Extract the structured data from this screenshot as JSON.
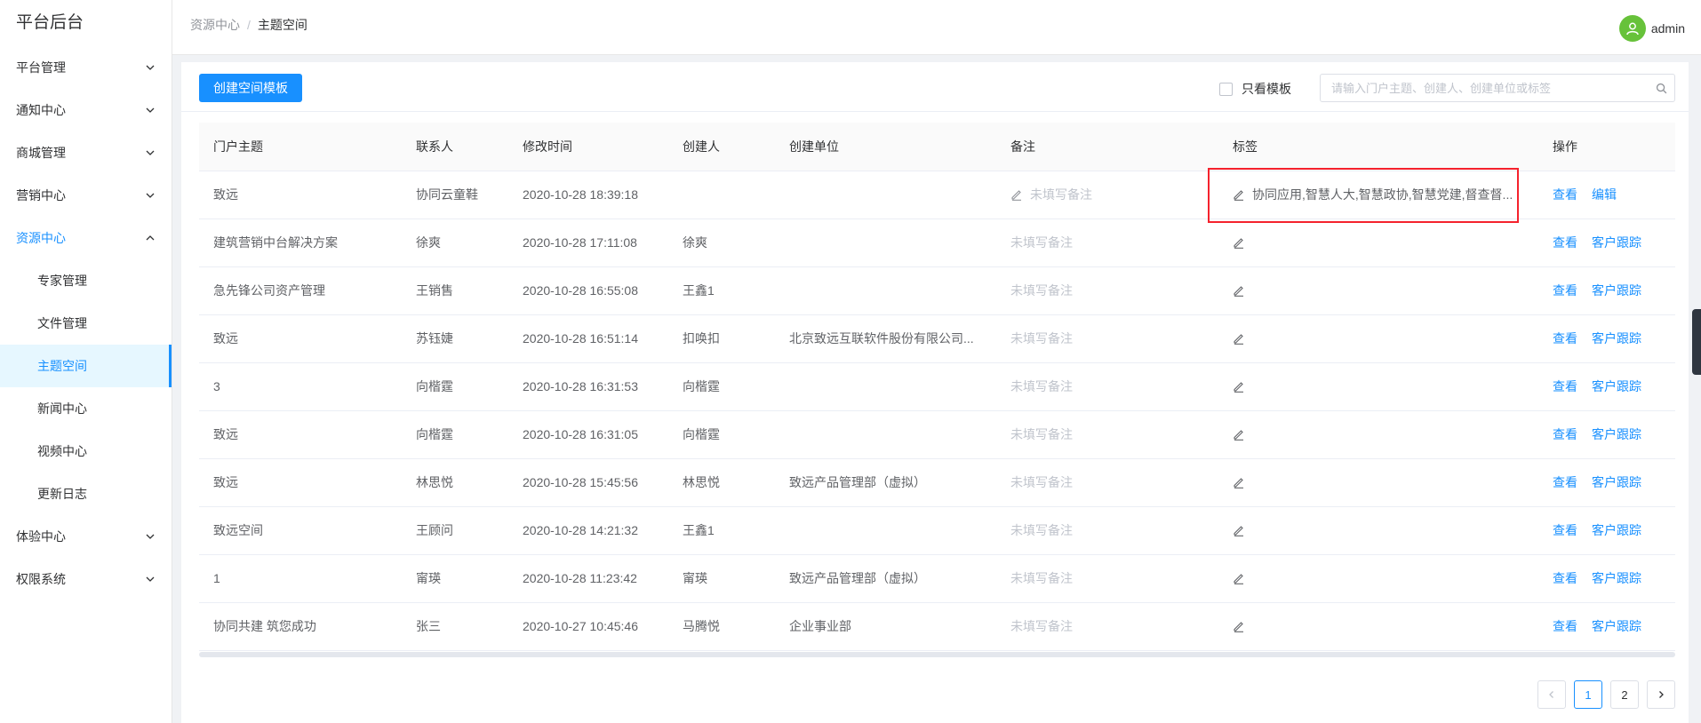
{
  "sidebar": {
    "title": "平台后台",
    "menu": [
      {
        "label": "平台管理"
      },
      {
        "label": "通知中心"
      },
      {
        "label": "商城管理"
      },
      {
        "label": "营销中心"
      },
      {
        "label": "资源中心",
        "open": true
      },
      {
        "label": "体验中心"
      },
      {
        "label": "权限系统"
      }
    ],
    "submenu": [
      {
        "label": "专家管理"
      },
      {
        "label": "文件管理"
      },
      {
        "label": "主题空间",
        "active": true
      },
      {
        "label": "新闻中心"
      },
      {
        "label": "视频中心"
      },
      {
        "label": "更新日志"
      }
    ]
  },
  "header": {
    "breadcrumb": [
      "资源中心",
      "主题空间"
    ],
    "separator": "/",
    "user": "admin"
  },
  "toolbar": {
    "create_label": "创建空间模板",
    "template_only_label": "只看模板",
    "search_placeholder": "请输入门户主题、创建人、创建单位或标签"
  },
  "table": {
    "columns": [
      "门户主题",
      "联系人",
      "修改时间",
      "创建人",
      "创建单位",
      "备注",
      "标签",
      "操作"
    ],
    "rows": [
      {
        "theme": "致远",
        "contact": "协同云童鞋",
        "modified": "2020-10-28 18:39:18",
        "creator": "",
        "unit": "",
        "remark": "未填写备注",
        "tags": "协同应用,智慧人大,智慧政协,智慧党建,督查督...",
        "actions": [
          "查看",
          "编辑"
        ]
      },
      {
        "theme": "建筑营销中台解决方案",
        "contact": "徐爽",
        "modified": "2020-10-28 17:11:08",
        "creator": "徐爽",
        "unit": "",
        "remark": "未填写备注",
        "tags": "",
        "actions": [
          "查看",
          "客户跟踪"
        ]
      },
      {
        "theme": "急先锋公司资产管理",
        "contact": "王销售",
        "modified": "2020-10-28 16:55:08",
        "creator": "王鑫1",
        "unit": "",
        "remark": "未填写备注",
        "tags": "",
        "actions": [
          "查看",
          "客户跟踪"
        ]
      },
      {
        "theme": "致远",
        "contact": "苏钰婕",
        "modified": "2020-10-28 16:51:14",
        "creator": "扣唤扣",
        "unit": "北京致远互联软件股份有限公司...",
        "remark": "未填写备注",
        "tags": "",
        "actions": [
          "查看",
          "客户跟踪"
        ]
      },
      {
        "theme": "3",
        "contact": "向楷霆",
        "modified": "2020-10-28 16:31:53",
        "creator": "向楷霆",
        "unit": "",
        "remark": "未填写备注",
        "tags": "",
        "actions": [
          "查看",
          "客户跟踪"
        ]
      },
      {
        "theme": "致远",
        "contact": "向楷霆",
        "modified": "2020-10-28 16:31:05",
        "creator": "向楷霆",
        "unit": "",
        "remark": "未填写备注",
        "tags": "",
        "actions": [
          "查看",
          "客户跟踪"
        ]
      },
      {
        "theme": "致远",
        "contact": "林思悦",
        "modified": "2020-10-28 15:45:56",
        "creator": "林思悦",
        "unit": "致远产品管理部（虚拟）",
        "remark": "未填写备注",
        "tags": "",
        "actions": [
          "查看",
          "客户跟踪"
        ]
      },
      {
        "theme": "致远空间",
        "contact": "王顾问",
        "modified": "2020-10-28 14:21:32",
        "creator": "王鑫1",
        "unit": "",
        "remark": "未填写备注",
        "tags": "",
        "actions": [
          "查看",
          "客户跟踪"
        ]
      },
      {
        "theme": "1",
        "contact": "甯瑛",
        "modified": "2020-10-28 11:23:42",
        "creator": "甯瑛",
        "unit": "致远产品管理部（虚拟）",
        "remark": "未填写备注",
        "tags": "",
        "actions": [
          "查看",
          "客户跟踪"
        ]
      },
      {
        "theme": "协同共建 筑您成功",
        "contact": "张三",
        "modified": "2020-10-27 10:45:46",
        "creator": "马腾悦",
        "unit": "企业事业部",
        "remark": "未填写备注",
        "tags": "",
        "actions": [
          "查看",
          "客户跟踪"
        ]
      }
    ]
  },
  "pagination": {
    "pages": [
      "1",
      "2"
    ],
    "current": "1"
  },
  "colors": {
    "accent": "#1890ff",
    "highlight": "#f5222d",
    "avatar": "#67c23a"
  }
}
